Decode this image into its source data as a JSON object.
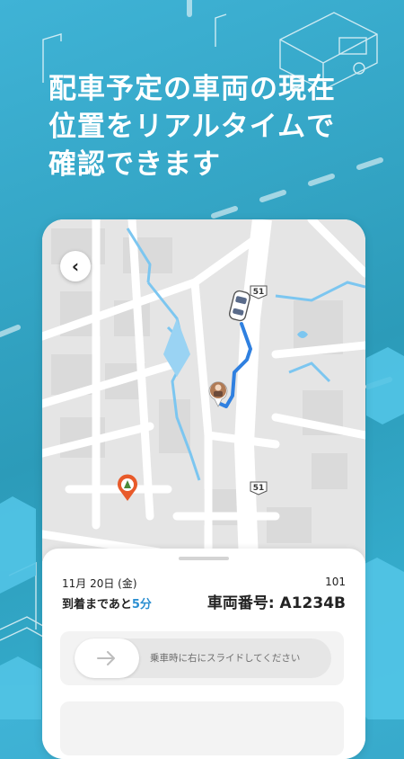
{
  "headline": {
    "line1": "配車予定の車両の現在",
    "line2": "位置をリアルタイムで",
    "line3": "確認できます"
  },
  "map": {
    "back_icon": "chevron-left-icon",
    "road_label_top": "51",
    "road_label_bottom": "51"
  },
  "trip": {
    "date": "11月 20日 (金)",
    "eta_prefix": "到着まであと",
    "eta_minutes": "5分",
    "car_number": "101",
    "plate_label": "車両番号: A1234B"
  },
  "slider": {
    "icon": "arrow-right-icon",
    "label": "乗車時に右にスライドしてください"
  },
  "colors": {
    "background": "#3fb3d6",
    "route": "#2f80e0",
    "accent": "#2c8fd1",
    "destination_pin": "#e85a2a"
  }
}
